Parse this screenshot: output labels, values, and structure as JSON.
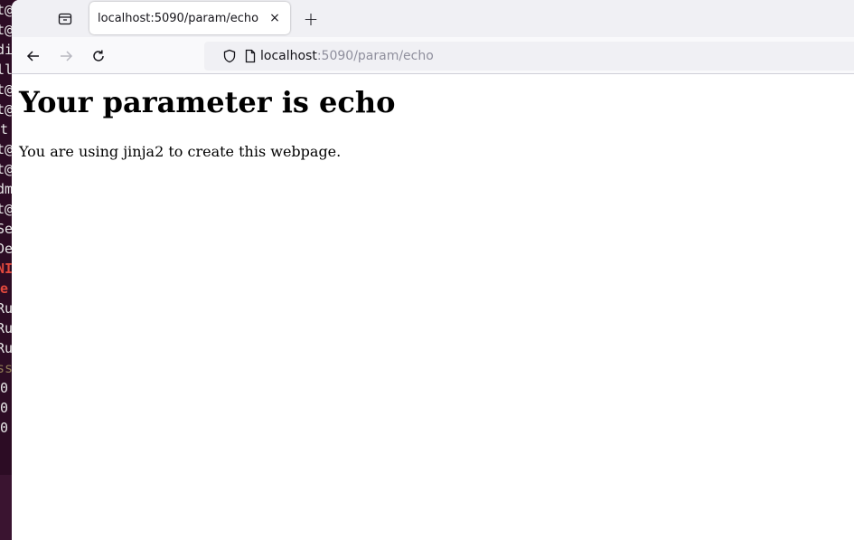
{
  "terminal": {
    "lines": [
      {
        "text": "t@",
        "style": "normal"
      },
      {
        "text": "t@",
        "style": "normal"
      },
      {
        "text": "di",
        "style": "normal"
      },
      {
        "text": "ll",
        "style": "normal"
      },
      {
        "text": "t@",
        "style": "normal"
      },
      {
        "text": "t@",
        "style": "normal"
      },
      {
        "text": "t",
        "style": "normal"
      },
      {
        "text": "t@",
        "style": "normal"
      },
      {
        "text": "t@",
        "style": "normal"
      },
      {
        "text": "dm",
        "style": "normal"
      },
      {
        "text": "t@",
        "style": "normal"
      },
      {
        "text": "Se",
        "style": "normal"
      },
      {
        "text": "De",
        "style": "normal"
      },
      {
        "text": "NI",
        "style": "red"
      },
      {
        "text": "e",
        "style": "red"
      },
      {
        "text": "Ru",
        "style": "normal"
      },
      {
        "text": "Ru",
        "style": "normal"
      },
      {
        "text": "Ru",
        "style": "normal"
      },
      {
        "text": "ss",
        "style": "warn"
      },
      {
        "text": "0",
        "style": "normal"
      },
      {
        "text": "0",
        "style": "normal"
      },
      {
        "text": "0",
        "style": "normal"
      }
    ]
  },
  "browser": {
    "tab": {
      "title": "localhost:5090/param/echo",
      "close_glyph": "×"
    },
    "new_tab_glyph": "+",
    "url": {
      "host": "localhost",
      "rest": ":5090/param/echo"
    },
    "icons": {
      "tab_overview": "tab-overview-icon",
      "back": "back-arrow-icon",
      "forward": "forward-arrow-icon",
      "reload": "reload-icon",
      "shield": "tracking-protection-shield-icon",
      "page": "page-info-icon"
    },
    "colors": {
      "tabstrip": "#f0f0f4",
      "toolbar": "#f9f9fb",
      "url_dim": "#8f8f9d",
      "forward_disabled": "#b8b8c0"
    }
  },
  "page": {
    "heading": "Your parameter is echo",
    "text": "You are using jinja2 to create this webpage."
  }
}
